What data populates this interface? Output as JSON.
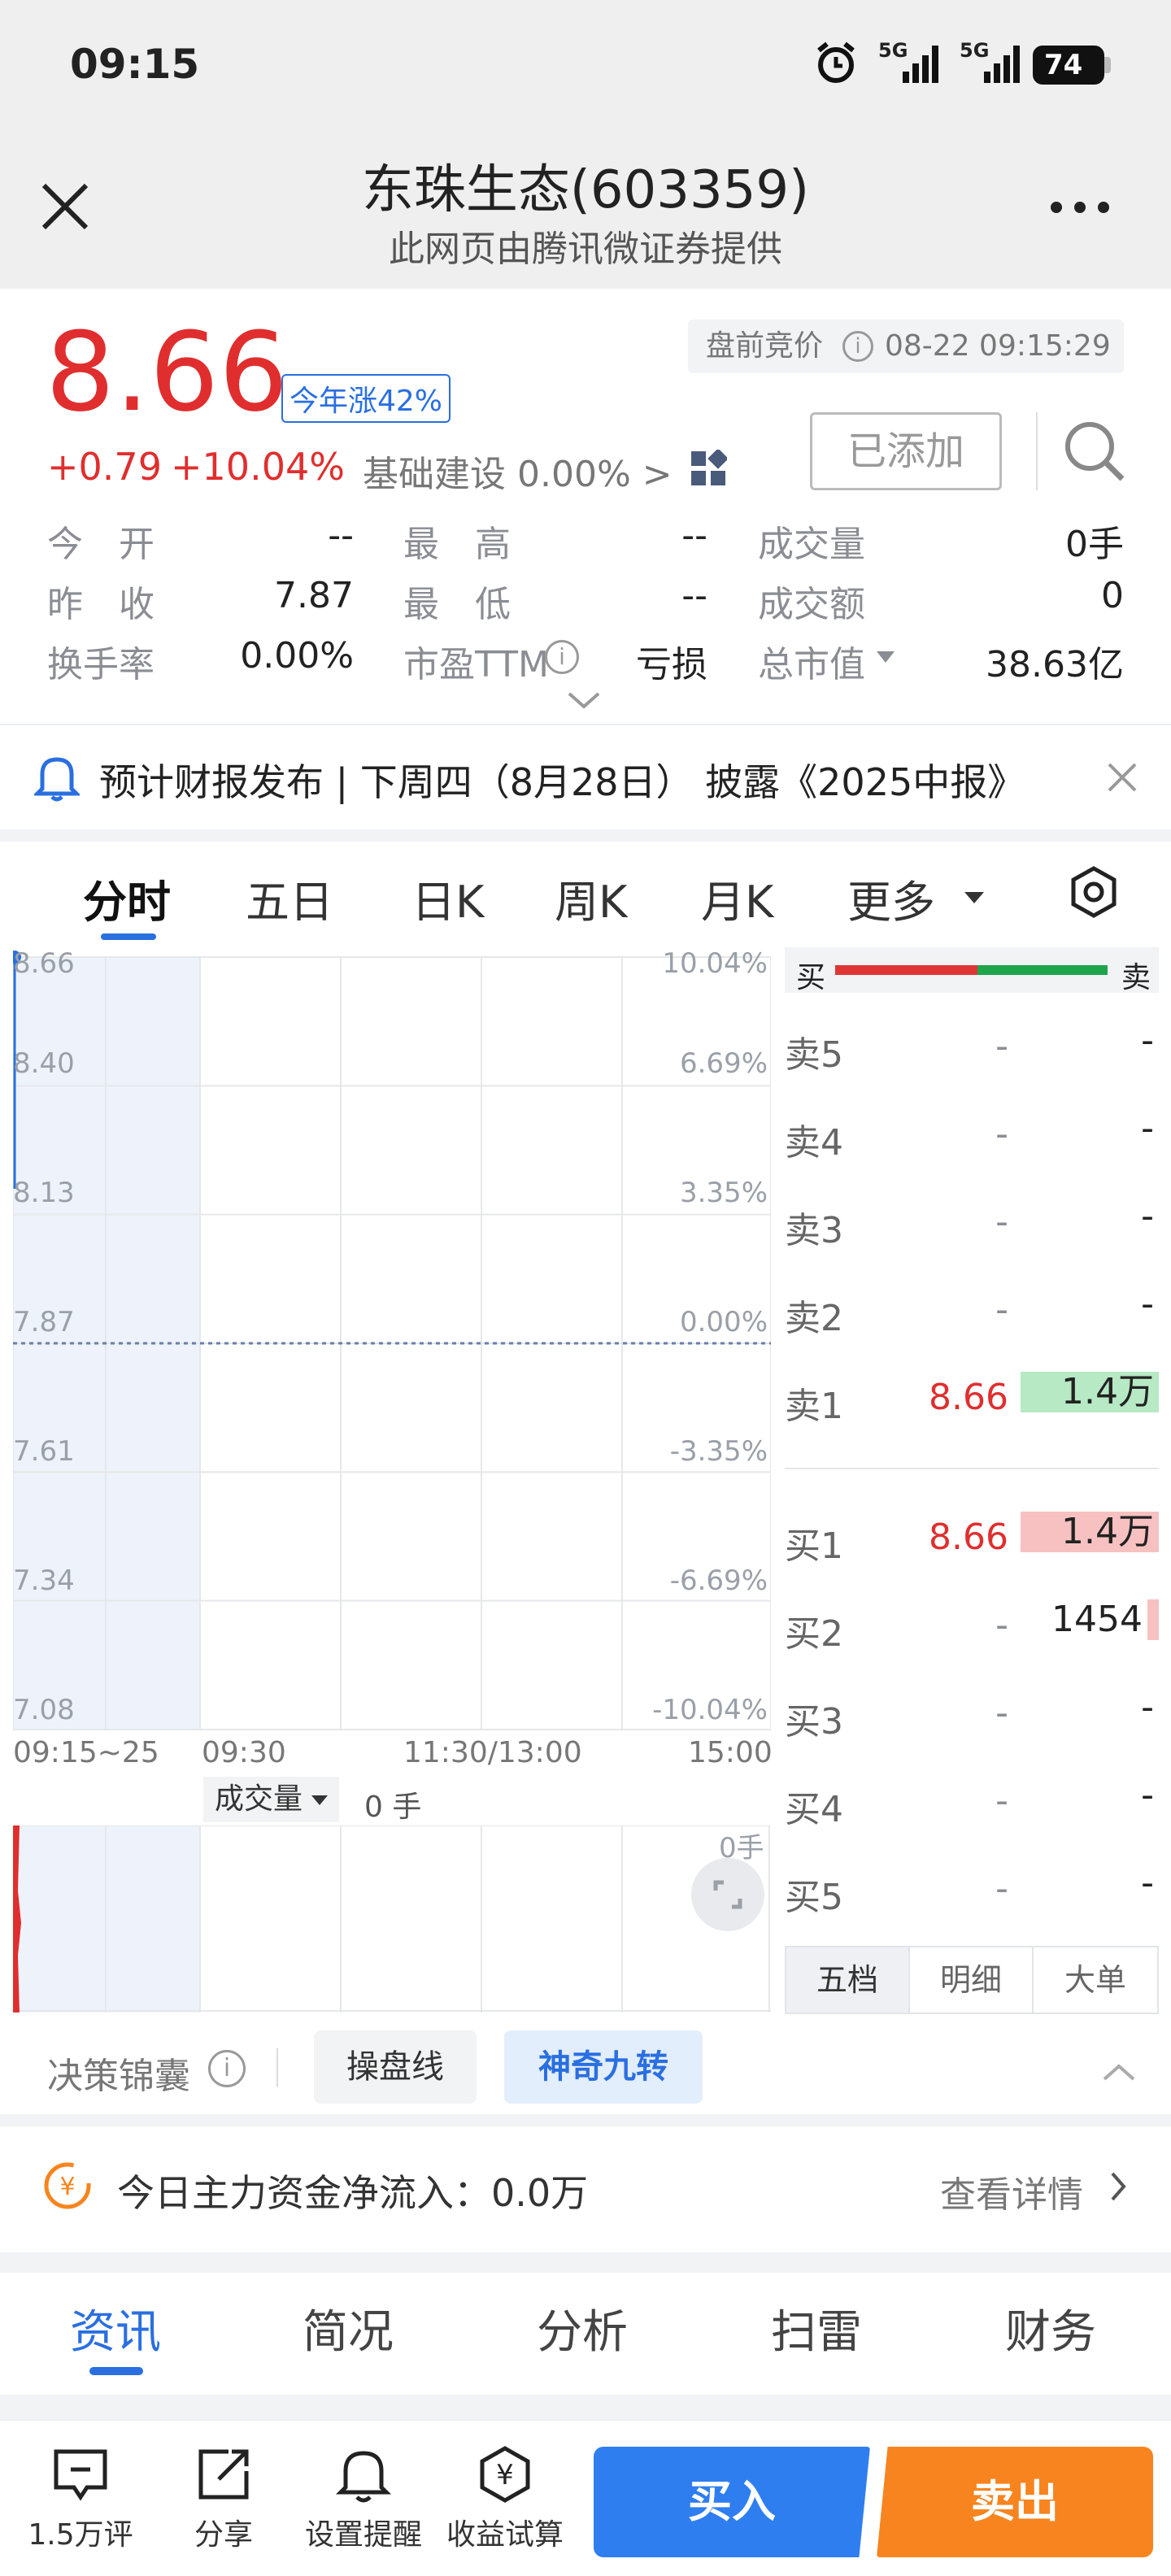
{
  "status": {
    "time": "09:15",
    "signal1": "5G",
    "signal2": "5G",
    "battery": "74"
  },
  "header": {
    "title": "东珠生态(603359)",
    "subtitle": "此网页由腾讯微证券提供"
  },
  "quote": {
    "price": "8.66",
    "ytd_badge": "今年涨42%",
    "change": "+0.79",
    "change_pct": "+10.04%",
    "sector": "基础建设 0.00%",
    "sector_arrow": ">",
    "session_label": "盘前竞价",
    "timestamp": "08-22 09:15:29",
    "added_button": "已添加",
    "stats": [
      {
        "label": "今　开",
        "value": "--"
      },
      {
        "label": "最　高",
        "value": "--"
      },
      {
        "label": "成交量",
        "value": "0手"
      },
      {
        "label": "昨　收",
        "value": "7.87"
      },
      {
        "label": "最　低",
        "value": "--"
      },
      {
        "label": "成交额",
        "value": "0"
      },
      {
        "label": "换手率",
        "value": "0.00%"
      },
      {
        "label": "市盈TTM",
        "value": "亏损"
      },
      {
        "label": "总市值",
        "value": "38.63亿"
      }
    ]
  },
  "notice": {
    "text": "预计财报发布 | 下周四（8月28日） 披露《2025中报》"
  },
  "chart_tabs": [
    "分时",
    "五日",
    "日K",
    "周K",
    "月K",
    "更多"
  ],
  "chart_data": {
    "type": "line",
    "title": "",
    "y_left_ticks": [
      "8.66",
      "8.40",
      "8.13",
      "7.87",
      "7.61",
      "7.34",
      "7.08"
    ],
    "y_right_ticks": [
      "10.04%",
      "6.69%",
      "3.35%",
      "0.00%",
      "-3.35%",
      "-6.69%",
      "-10.04%"
    ],
    "x_ticks": [
      "09:15~25",
      "09:30",
      "11:30/13:00",
      "15:00"
    ],
    "ylim": [
      7.08,
      8.66
    ],
    "prev_close": 7.87,
    "series": [
      {
        "x": [
          "09:15"
        ],
        "values": [
          8.66
        ]
      }
    ],
    "volume_label": "成交量",
    "volume_value": "0 手",
    "volume_right": "0手"
  },
  "orderbook": {
    "header_buy": "买",
    "header_sell": "卖",
    "asks": [
      {
        "label": "卖5",
        "price": "-",
        "vol": "-"
      },
      {
        "label": "卖4",
        "price": "-",
        "vol": "-"
      },
      {
        "label": "卖3",
        "price": "-",
        "vol": "-"
      },
      {
        "label": "卖2",
        "price": "-",
        "vol": "-"
      },
      {
        "label": "卖1",
        "price": "8.66",
        "vol": "1.4万"
      }
    ],
    "bids": [
      {
        "label": "买1",
        "price": "8.66",
        "vol": "1.4万"
      },
      {
        "label": "买2",
        "price": "-",
        "vol": "1454"
      },
      {
        "label": "买3",
        "price": "-",
        "vol": "-"
      },
      {
        "label": "买4",
        "price": "-",
        "vol": "-"
      },
      {
        "label": "买5",
        "price": "-",
        "vol": "-"
      }
    ],
    "tabs": [
      "五档",
      "明细",
      "大单"
    ]
  },
  "tools": {
    "label": "决策锦囊",
    "btn1": "操盘线",
    "btn2": "神奇九转"
  },
  "flow": {
    "text": "今日主力资金净流入：0.0万",
    "link": "查看详情"
  },
  "news_tabs": [
    "资讯",
    "简况",
    "分析",
    "扫雷",
    "财务"
  ],
  "bottom": {
    "comments": "1.5万评",
    "share": "分享",
    "alert": "设置提醒",
    "calc": "收益试算",
    "buy": "买入",
    "sell": "卖出"
  },
  "colors": {
    "up": "#e02e2e",
    "down": "#18a058",
    "accent": "#2a6fe0",
    "sell_btn": "#f7841e"
  }
}
